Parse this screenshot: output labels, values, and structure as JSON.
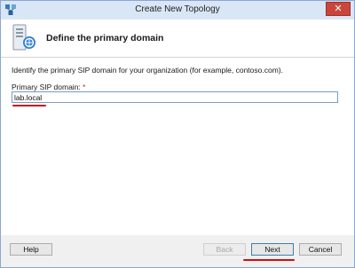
{
  "window": {
    "title": "Create New Topology",
    "close_glyph": "✕"
  },
  "header": {
    "title": "Define the primary domain",
    "icon": "server-domain-icon"
  },
  "content": {
    "instruction": "Identify the primary SIP domain for your organization (for example, contoso.com).",
    "field_label": "Primary SIP domain:",
    "required_marker": "*",
    "domain_value": "lab.local"
  },
  "footer": {
    "help_label": "Help",
    "back_label": "Back",
    "next_label": "Next",
    "cancel_label": "Cancel"
  },
  "colors": {
    "titlebar": "#d9e6f5",
    "close_button": "#c9463d",
    "annotation_red": "#cc1010",
    "required_red": "#cc1e1e"
  }
}
